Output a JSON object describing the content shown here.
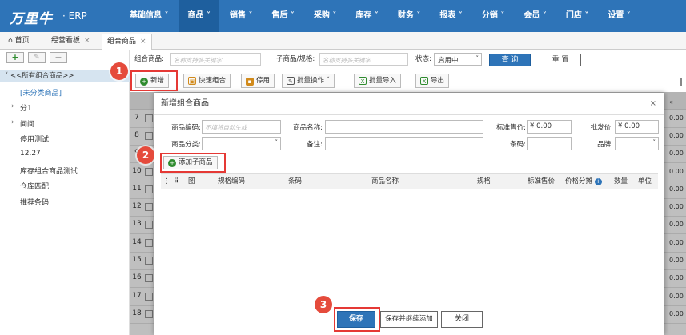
{
  "header": {
    "logo": "万里牛",
    "logo_suffix": "· ERP",
    "nav": [
      "基础信息 ˅",
      "商品 ˅",
      "销售 ˅",
      "售后 ˅",
      "采购 ˅",
      "库存 ˅",
      "财务 ˅",
      "报表 ˅",
      "分销 ˅",
      "会员 ˅",
      "门店 ˅",
      "设置 ˅"
    ],
    "active_nav": 1
  },
  "tabs": [
    {
      "label": "首页",
      "closable": false
    },
    {
      "label": "经营看板",
      "closable": true
    },
    {
      "label": "组合商品",
      "closable": true
    }
  ],
  "sidebar": {
    "add": "+",
    "edit": "✎",
    "remove": "−",
    "root": "<<所有组合商品>>",
    "items": [
      "[未分类商品]",
      "分1",
      "间间",
      "停用测试",
      "12.27",
      "库存组合商品测试",
      "仓库匹配",
      "推荐条码"
    ]
  },
  "filters": {
    "combo_label": "组合商品:",
    "combo_placeholder": "名称支持多关键字...",
    "sub_label": "子商品/规格:",
    "sub_placeholder": "名称支持多关键字...",
    "status_label": "状态:",
    "status_value": "启用中",
    "query": "查 询",
    "reset": "重 置"
  },
  "toolbar": {
    "new": "新增",
    "quick": "快速组合",
    "disable": "停用",
    "batch": "批量操作",
    "import": "批量导入",
    "export": "导出"
  },
  "grid": {
    "rows": [
      "7",
      "8",
      "9",
      "10",
      "11",
      "12",
      "13",
      "14",
      "15",
      "16",
      "17",
      "18"
    ],
    "right_values": [
      "0.00",
      "0.00",
      "0.00",
      "0.00",
      "0.00",
      "0.00",
      "0.00",
      "0.00",
      "0.00",
      "0.00",
      "0.00",
      "0.00"
    ],
    "header_right": "«"
  },
  "modal": {
    "title": "新增组合商品",
    "close": "×",
    "code_label": "商品编码:",
    "code_placeholder": "不填将自动生成",
    "name_label": "商品名称:",
    "price_label": "标准售价:",
    "price_value": "¥ 0.00",
    "wholesale_label": "批发价:",
    "wholesale_value": "¥ 0.00",
    "category_label": "商品分类:",
    "remark_label": "备注:",
    "barcode_label": "条码:",
    "brand_label": "品牌:",
    "add_sub": "添加子商品",
    "columns": [
      "⋮",
      "⠿",
      "图",
      "规格编码",
      "条码",
      "商品名称",
      "规格",
      "标准售价",
      "价格分摊",
      "数量",
      "单位"
    ],
    "save": "保存",
    "save_continue": "保存并继续添加",
    "close_btn": "关闭"
  },
  "callouts": [
    "1",
    "2",
    "3"
  ],
  "colors": {
    "brand": "#2e74b8",
    "callout": "#e54b3c",
    "highlight": "#e53935"
  }
}
